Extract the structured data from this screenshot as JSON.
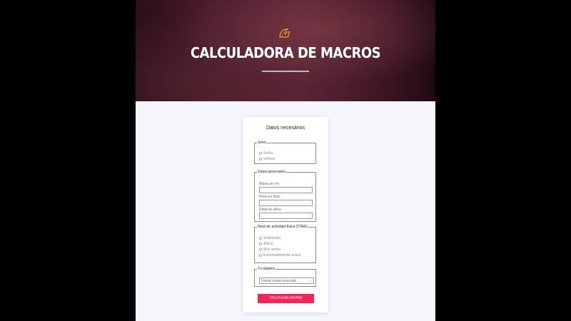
{
  "hero": {
    "title": "CALCULADORA DE MACROS"
  },
  "form": {
    "title": "Datos necesários",
    "sexo": {
      "legend": "Sexo",
      "options": [
        "Señor",
        "Señora"
      ]
    },
    "personales": {
      "legend": "Datos personales",
      "fields": [
        {
          "label": "Altura en cm",
          "value": ""
        },
        {
          "label": "Peso en kilos",
          "value": ""
        },
        {
          "label": "Edad en años",
          "value": ""
        }
      ]
    },
    "actividad": {
      "legend": "Nivel de actividad física (TDEE)",
      "options": [
        "Sedentario",
        "Activo",
        "Muy activo",
        "Extremadamente activo"
      ]
    },
    "objetivo": {
      "legend": "Tu objetivo",
      "selected": "Ganar masa muscular"
    },
    "submit_label": "CALCULAR AHORA"
  },
  "colors": {
    "accent": "#f0265a",
    "background": "#f3f7fc",
    "outer": "#000000"
  },
  "icons": {
    "logo": "flame-logo-icon",
    "select": "chevron-down-icon"
  }
}
